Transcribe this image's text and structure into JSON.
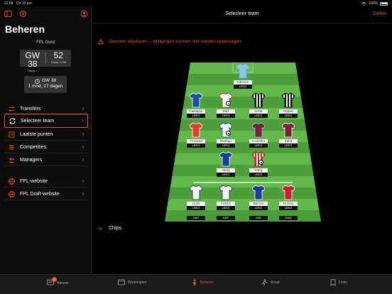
{
  "status": {
    "time": "22:58",
    "date": "Do 15 jun.",
    "battery": "100%"
  },
  "sidebar": {
    "title": "Beheren",
    "user": "FPL Gunz",
    "gw_label": "GW 38",
    "rank": "Rang 1",
    "points": "52",
    "total": "Totaal: 2726",
    "deadline_gw": "GW 38",
    "deadline_time": "1 mnd, 27 dagen",
    "menu": [
      {
        "label": "Transfers",
        "icon": "transfer-arrows-icon"
      },
      {
        "label": "Selecteer team",
        "icon": "refresh-icon"
      },
      {
        "label": "Laatste punten",
        "icon": "list-icon"
      },
      {
        "label": "Competities",
        "icon": "sliders-icon"
      },
      {
        "label": "Managers",
        "icon": "people-icon"
      }
    ],
    "links": [
      {
        "label": "FPL-website",
        "icon": "globe-icon"
      },
      {
        "label": "FPL Draft-website",
        "icon": "globe-icon"
      }
    ]
  },
  "header": {
    "title": "Selecteer team",
    "share": "Delen"
  },
  "warning": "Seizoen afgelopen – wizigingen kunnen niet worden opgeslagen",
  "pitch": {
    "rows": [
      [
        {
          "name": "Ederson",
          "pts": "LEEG",
          "kit": "#8ec6ea",
          "trim": "#6aa8d8"
        }
      ],
      [
        {
          "name": "Castagne",
          "pts": "LEEG",
          "kit": "#1c4fa8",
          "trim": "#ffffff"
        },
        {
          "name": "Diaz",
          "pts": "LEEG",
          "kit": "#ffffff",
          "trim": "#cc2222",
          "badge": "cap"
        },
        {
          "name": "Schär",
          "pts": "LEEG",
          "kit": "stripes-bw",
          "trim": "#000000"
        },
        {
          "name": "Trippier",
          "pts": "LEEG",
          "kit": "stripes-bw",
          "trim": "#000000"
        }
      ],
      [
        {
          "name": "Trossard",
          "pts": "LEEG",
          "kit": "#e8372b",
          "trim": "#ffffff"
        },
        {
          "name": "Rodrigo",
          "pts": "LEEG",
          "kit": "#f2f2f2",
          "trim": "#1c3f8c",
          "badge": "vice"
        },
        {
          "name": "Coutinho",
          "pts": "LEEG",
          "kit": "#7a1e3c",
          "trim": "#93c5e8"
        },
        {
          "name": "Zaha",
          "pts": "LEEG",
          "kit": "#7b1e3a",
          "trim": "#ffffff"
        }
      ],
      [
        {
          "name": "Vardy",
          "pts": "LEEG",
          "kit": "#1a3d9e",
          "trim": "#ffffff"
        },
        {
          "name": "Toney",
          "pts": "LEEG",
          "kit": "stripes-rw",
          "trim": "#cc0000",
          "badge": "vice"
        }
      ]
    ],
    "bench": [
      {
        "name": "Lloris",
        "pts": "LEEG",
        "kit": "#f2f2f2",
        "trim": "#1c2a5a"
      },
      {
        "name": "Perišić",
        "pts": "LEEG",
        "kit": "#f2f2f2",
        "trim": "#1c2a5a"
      },
      {
        "name": "Barnes",
        "pts": "LEEG",
        "kit": "#1a3d9e",
        "trim": "#ffffff"
      },
      {
        "name": "Firmino",
        "pts": "LEEG",
        "kit": "#cc1f2d",
        "trim": "#ffffff"
      }
    ],
    "bench_positions": [
      "GKP",
      "DEF",
      "MID",
      "FWD"
    ]
  },
  "chips_label": "Chips",
  "tabs": [
    {
      "label": "Nieuws",
      "icon": "news-icon",
      "badge": "9"
    },
    {
      "label": "Wedstrijden",
      "icon": "calendar-icon"
    },
    {
      "label": "Beheren",
      "icon": "manager-icon"
    },
    {
      "label": "Scout",
      "icon": "running-icon"
    },
    {
      "label": "Links",
      "icon": "bookmark-icon"
    }
  ],
  "colors": {
    "accent": "#e8502a",
    "pitch_light": "#62b84a",
    "pitch_dark": "#4f9e3c",
    "background": "#000000"
  }
}
